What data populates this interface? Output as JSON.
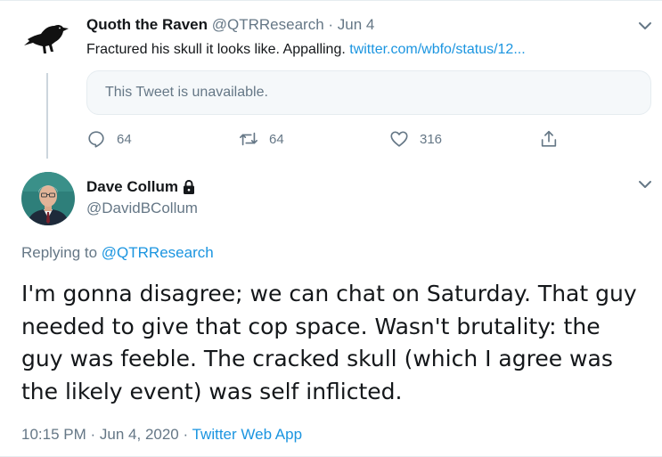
{
  "tweet_parent": {
    "author_name": "Quoth the Raven",
    "handle": "@QTRResearch",
    "separator": "·",
    "date": "Jun 4",
    "text": "Fractured his skull it looks like. Appalling. ",
    "link_text": "twitter.com/wbfo/status/12...",
    "quoted_unavailable": "This Tweet is unavailable.",
    "reply_count": "64",
    "retweet_count": "64",
    "like_count": "316",
    "avatar_icon": "raven-icon"
  },
  "tweet_main": {
    "author_name": "Dave Collum",
    "handle": "@DavidBCollum",
    "protected_icon": "lock-icon",
    "replying_to_prefix": "Replying to ",
    "replying_to_handle": "@QTRResearch",
    "body": "I'm gonna disagree; we can chat on Saturday. That guy needed to give that cop space. Wasn't brutality: the guy was feeble. The cracked skull (which I agree was the likely event) was self inflicted.",
    "time": "10:15 PM",
    "date": "Jun 4, 2020",
    "meta_sep": "·",
    "source": "Twitter Web App"
  },
  "colors": {
    "link": "#1b95e0",
    "muted": "#657786",
    "text": "#14171a",
    "border": "#e6ecf0"
  }
}
